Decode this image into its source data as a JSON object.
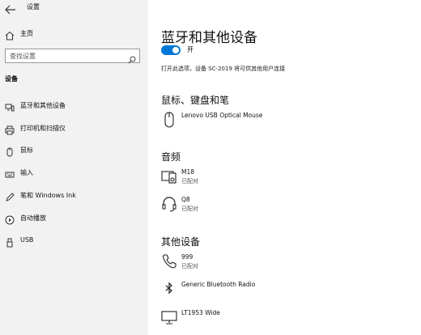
{
  "window": {
    "title": "设置"
  },
  "sidebar": {
    "home_label": "主页",
    "search_placeholder": "查找设置",
    "section_label": "设备",
    "items": [
      {
        "label": "蓝牙和其他设备",
        "icon": "bluetooth-devices-icon"
      },
      {
        "label": "打印机和扫描仪",
        "icon": "printer-icon"
      },
      {
        "label": "鼠标",
        "icon": "mouse-icon"
      },
      {
        "label": "输入",
        "icon": "keyboard-icon"
      },
      {
        "label": "笔和 Windows Ink",
        "icon": "pen-icon"
      },
      {
        "label": "自动播放",
        "icon": "autoplay-icon"
      },
      {
        "label": "USB",
        "icon": "usb-icon"
      }
    ]
  },
  "main": {
    "title": "蓝牙和其他设备",
    "toggle_label": "开",
    "toggle_on": true,
    "hint": "打开此选项，设备 SC-2019 将可供其他用户连接",
    "groups": [
      {
        "heading": "鼠标、键盘和笔",
        "devices": [
          {
            "name": "Lenovo USB Optical Mouse",
            "status": "",
            "icon": "mouse-icon"
          }
        ]
      },
      {
        "heading": "音频",
        "devices": [
          {
            "name": "M18",
            "status": "已配对",
            "icon": "media-device-icon"
          },
          {
            "name": "Q8",
            "status": "已配对",
            "icon": "headset-icon"
          }
        ]
      },
      {
        "heading": "其他设备",
        "devices": [
          {
            "name": "999",
            "status": "已配对",
            "icon": "phone-icon"
          },
          {
            "name": "Generic Bluetooth Radio",
            "status": "",
            "icon": "bluetooth-icon"
          },
          {
            "name": "LT1953 Wide",
            "status": "",
            "icon": "monitor-icon"
          }
        ]
      }
    ]
  },
  "colors": {
    "accent": "#0078d7",
    "sidebar_bg": "#f2f2f2"
  }
}
